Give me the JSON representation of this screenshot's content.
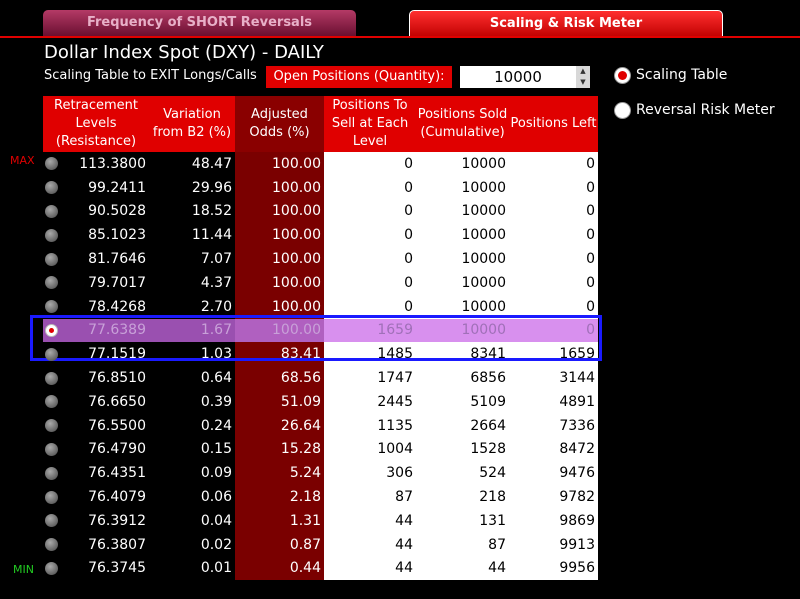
{
  "tabs": {
    "reversals": "Frequency of SHORT Reversals",
    "scaling": "Scaling & Risk Meter"
  },
  "title": "Dollar Index Spot (DXY) - DAILY",
  "subtitle": "Scaling Table to EXIT Longs/Calls",
  "open_positions_label": "Open Positions (Quantity):",
  "quantity": "10000",
  "options": {
    "scaling_table": "Scaling Table",
    "reversal_risk_meter": "Reversal Risk Meter"
  },
  "markers": {
    "max": "MAX",
    "min": "MIN"
  },
  "headers": {
    "levels": "Retracement Levels (Resistance)",
    "variation": "Variation from B2 (%)",
    "odds": "Adjusted Odds (%)",
    "to_sell": "Positions To Sell at Each Level",
    "sold": "Positions Sold (Cumulative)",
    "left": "Positions Left"
  },
  "rows": [
    {
      "level": "113.3800",
      "var": "48.47",
      "odds": "100.00",
      "sell": "0",
      "sold": "10000",
      "left": "0"
    },
    {
      "level": "99.2411",
      "var": "29.96",
      "odds": "100.00",
      "sell": "0",
      "sold": "10000",
      "left": "0"
    },
    {
      "level": "90.5028",
      "var": "18.52",
      "odds": "100.00",
      "sell": "0",
      "sold": "10000",
      "left": "0"
    },
    {
      "level": "85.1023",
      "var": "11.44",
      "odds": "100.00",
      "sell": "0",
      "sold": "10000",
      "left": "0"
    },
    {
      "level": "81.7646",
      "var": "7.07",
      "odds": "100.00",
      "sell": "0",
      "sold": "10000",
      "left": "0"
    },
    {
      "level": "79.7017",
      "var": "4.37",
      "odds": "100.00",
      "sell": "0",
      "sold": "10000",
      "left": "0"
    },
    {
      "level": "78.4268",
      "var": "2.70",
      "odds": "100.00",
      "sell": "0",
      "sold": "10000",
      "left": "0"
    },
    {
      "level": "77.6389",
      "var": "1.67",
      "odds": "100.00",
      "sell": "1659",
      "sold": "10000",
      "left": "0"
    },
    {
      "level": "77.1519",
      "var": "1.03",
      "odds": "83.41",
      "sell": "1485",
      "sold": "8341",
      "left": "1659"
    },
    {
      "level": "76.8510",
      "var": "0.64",
      "odds": "68.56",
      "sell": "1747",
      "sold": "6856",
      "left": "3144"
    },
    {
      "level": "76.6650",
      "var": "0.39",
      "odds": "51.09",
      "sell": "2445",
      "sold": "5109",
      "left": "4891"
    },
    {
      "level": "76.5500",
      "var": "0.24",
      "odds": "26.64",
      "sell": "1135",
      "sold": "2664",
      "left": "7336"
    },
    {
      "level": "76.4790",
      "var": "0.15",
      "odds": "15.28",
      "sell": "1004",
      "sold": "1528",
      "left": "8472"
    },
    {
      "level": "76.4351",
      "var": "0.09",
      "odds": "5.24",
      "sell": "306",
      "sold": "524",
      "left": "9476"
    },
    {
      "level": "76.4079",
      "var": "0.06",
      "odds": "2.18",
      "sell": "87",
      "sold": "218",
      "left": "9782"
    },
    {
      "level": "76.3912",
      "var": "0.04",
      "odds": "1.31",
      "sell": "44",
      "sold": "131",
      "left": "9869"
    },
    {
      "level": "76.3807",
      "var": "0.02",
      "odds": "0.87",
      "sell": "44",
      "sold": "87",
      "left": "9913"
    },
    {
      "level": "76.3745",
      "var": "0.01",
      "odds": "0.44",
      "sell": "44",
      "sold": "44",
      "left": "9956"
    }
  ]
}
